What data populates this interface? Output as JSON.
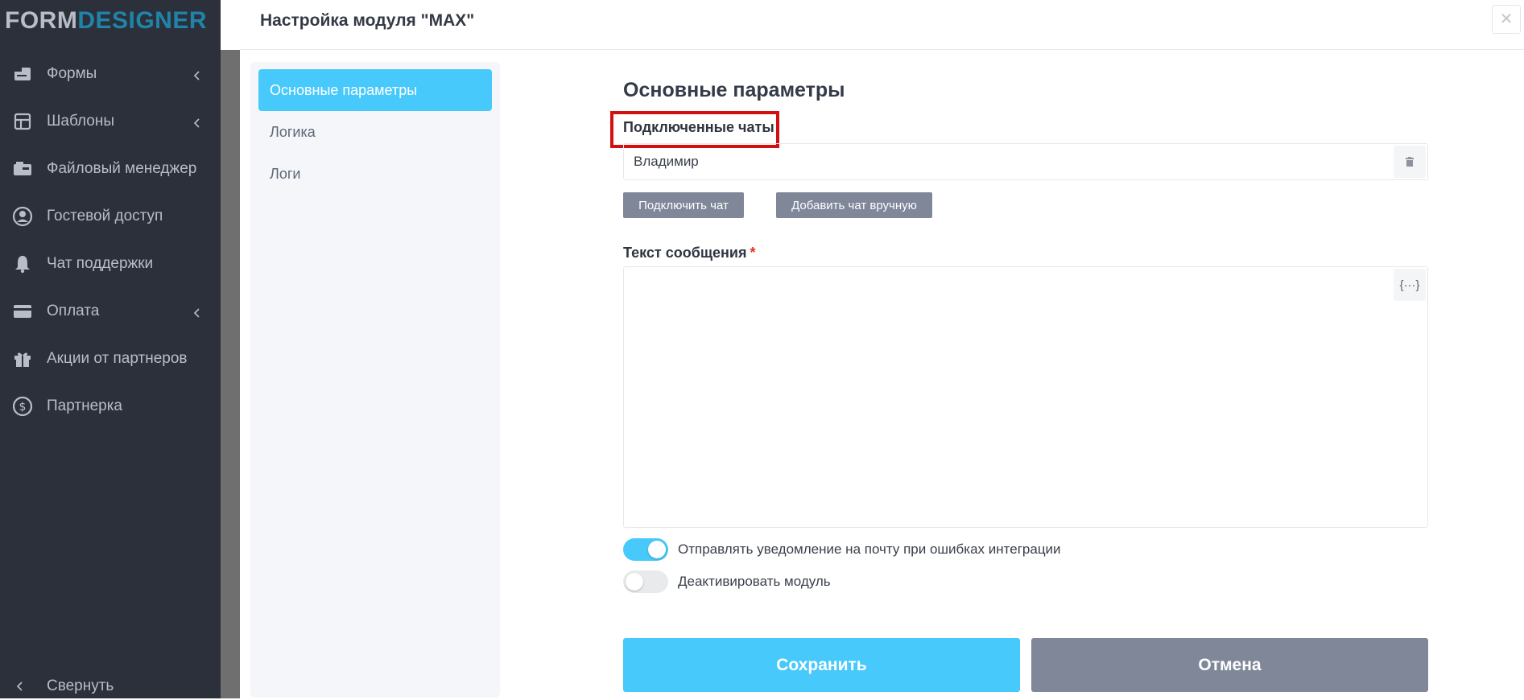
{
  "colors": {
    "sidebar_bg": "#2c303b",
    "accent": "#48c9fb",
    "logo_accent": "#1f84a8",
    "grey_button": "#7f8799",
    "highlight": "#d31010",
    "required": "#e8321e"
  },
  "app": {
    "logo_part1": "FORM",
    "logo_part2": "DESIGNER"
  },
  "sidebar": {
    "items": [
      {
        "label": "Формы",
        "icon": "forms-icon",
        "has_chevron": true
      },
      {
        "label": "Шаблоны",
        "icon": "templates-icon",
        "has_chevron": true
      },
      {
        "label": "Файловый менеджер",
        "icon": "file-manager-icon",
        "has_chevron": false
      },
      {
        "label": "Гостевой доступ",
        "icon": "guest-user-icon",
        "has_chevron": false
      },
      {
        "label": "Чат поддержки",
        "icon": "bell-icon",
        "has_chevron": false
      },
      {
        "label": "Оплата",
        "icon": "credit-card-icon",
        "has_chevron": true
      },
      {
        "label": "Акции от партнеров",
        "icon": "gift-icon",
        "has_chevron": false
      },
      {
        "label": "Партнерка",
        "icon": "dollar-icon",
        "has_chevron": false
      }
    ],
    "collapse_label": "Свернуть"
  },
  "modal": {
    "title": "Настройка модуля \"MAX\"",
    "close_glyph": "✕",
    "subnav": [
      {
        "label": "Основные параметры",
        "active": true
      },
      {
        "label": "Логика",
        "active": false
      },
      {
        "label": "Логи",
        "active": false
      }
    ],
    "section_title": "Основные параметры",
    "connected_chats_label": "Подключенные чаты",
    "chats": [
      {
        "name": "Владимир"
      }
    ],
    "connect_chat_label": "Подключить чат",
    "add_chat_manual_label": "Добавить чат вручную",
    "message_label": "Текст сообщения",
    "required_mark": "*",
    "message_value": "",
    "vars_button_label": "{···}",
    "toggles": {
      "email_notify": {
        "label": "Отправлять уведомление на почту при ошибках интеграции",
        "on": true
      },
      "deactivate": {
        "label": "Деактивировать модуль",
        "on": false
      }
    },
    "save_label": "Сохранить",
    "cancel_label": "Отмена"
  }
}
